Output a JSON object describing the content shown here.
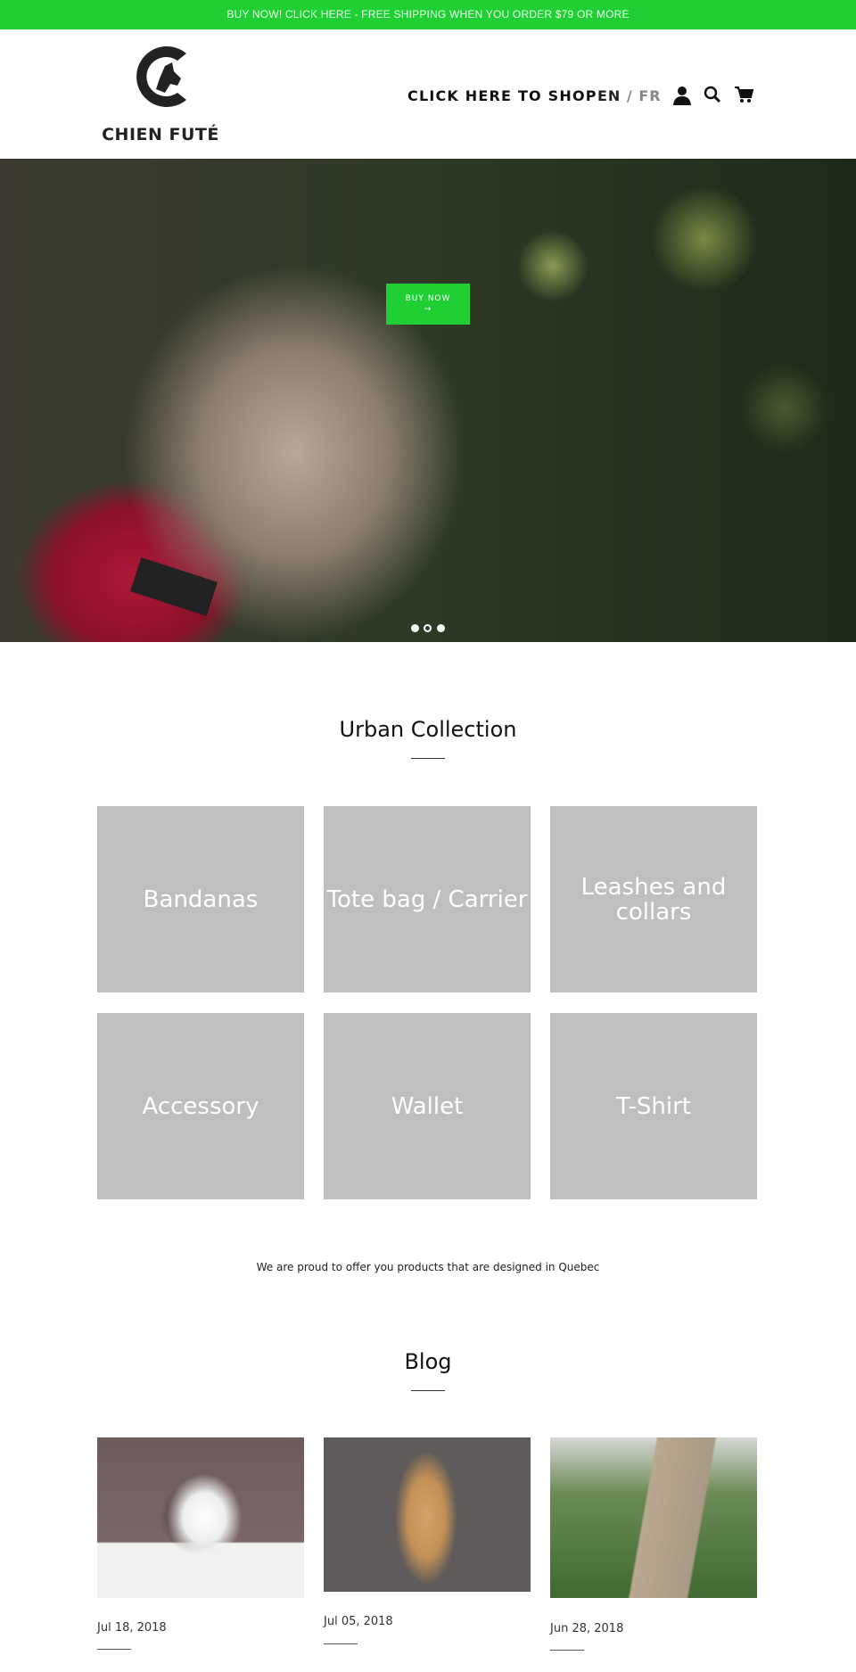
{
  "announcement": "BUY NOW! CLICK HERE - FREE SHIPPING WHEN YOU ORDER $79 OR MORE",
  "header": {
    "brand": "CHIEN FUTÉ",
    "nav_shop": "CLICK HERE TO SHOP",
    "lang_en": "EN",
    "lang_sep": "/",
    "lang_fr": "FR",
    "icons": [
      "account-icon",
      "search-icon",
      "cart-icon"
    ]
  },
  "hero": {
    "button_label": "BUY NOW",
    "button_arrow": "→",
    "slides": 3,
    "active_slide": 2
  },
  "collection": {
    "title": "Urban Collection",
    "tiles": [
      "Bandanas",
      "Tote bag / Carrier",
      "Leashes and collars",
      "Accessory",
      "Wallet",
      "T-Shirt"
    ]
  },
  "proud_text": "We are proud to offer you products that are designed in Quebec",
  "blog": {
    "title": "Blog",
    "posts": [
      {
        "date": "Jul 18, 2018"
      },
      {
        "date": "Jul 05, 2018"
      },
      {
        "date": "Jun 28, 2018"
      }
    ]
  },
  "colors": {
    "accent": "#1fcf33",
    "tile": "#bfbfbf"
  }
}
